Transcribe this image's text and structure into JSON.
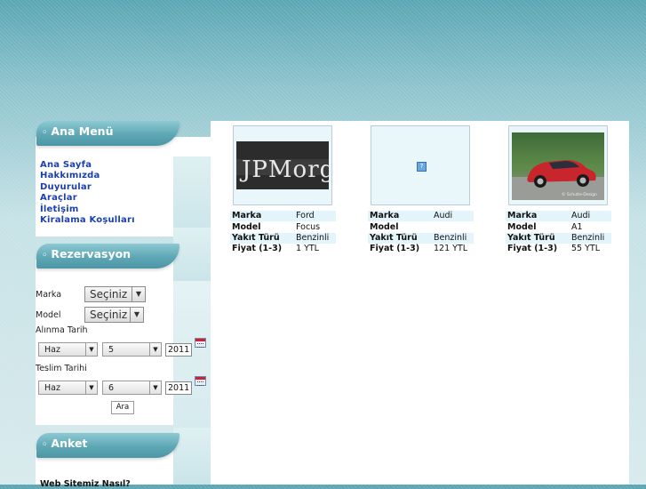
{
  "left": {
    "menu_title": "Ana Menü",
    "menu_items": [
      "Ana Sayfa",
      "Hakkımızda",
      "Duyurular",
      "Araçlar",
      "İletişim",
      "Kiralama Koşulları"
    ],
    "reservation_title": "Rezervasyon",
    "form": {
      "marka_label": "Marka",
      "marka_value": "Seçiniz",
      "model_label": "Model",
      "model_value": "Seçiniz",
      "alinma_label": "Alınma Tarih",
      "alinma_month": "Haz",
      "alinma_day": "5",
      "alinma_year": "2011",
      "teslim_label": "Teslim Tarihi",
      "teslim_month": "Haz",
      "teslim_day": "6",
      "teslim_year": "2011",
      "submit_label": "Ara"
    },
    "poll_title": "Anket",
    "poll_question": "Web Sitemiz Nasıl?"
  },
  "cars": [
    {
      "image": "jp-morgan-logo",
      "rows": [
        {
          "key": "Marka",
          "value": "Ford"
        },
        {
          "key": "Model",
          "value": "Focus"
        },
        {
          "key": "Yakıt Türü",
          "value": "Benzinli"
        },
        {
          "key": "Fiyat (1-3)",
          "value": "1 YTL"
        }
      ]
    },
    {
      "image": "broken-image-icon",
      "rows": [
        {
          "key": "Marka",
          "value": "Audi"
        },
        {
          "key": "Model",
          "value": ""
        },
        {
          "key": "Yakıt Türü",
          "value": "Benzinli"
        },
        {
          "key": "Fiyat (1-3)",
          "value": "121 YTL"
        }
      ]
    },
    {
      "image": "red-audi-car",
      "image_caption": "© Schulte-Design",
      "rows": [
        {
          "key": "Marka",
          "value": "Audi"
        },
        {
          "key": "Model",
          "value": "A1"
        },
        {
          "key": "Yakıt Türü",
          "value": "Benzinli"
        },
        {
          "key": "Fiyat (1-3)",
          "value": "55 YTL"
        }
      ]
    }
  ]
}
